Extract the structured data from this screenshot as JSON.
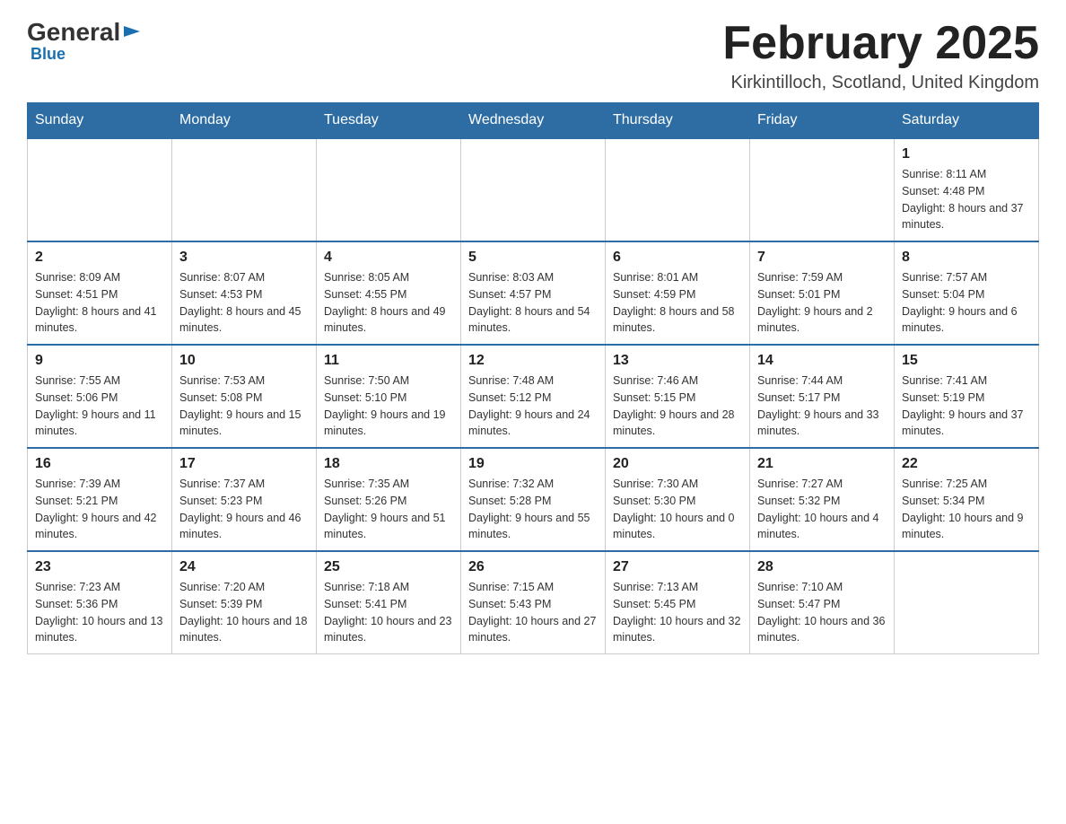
{
  "logo": {
    "general": "General",
    "blue": "Blue"
  },
  "header": {
    "title": "February 2025",
    "subtitle": "Kirkintilloch, Scotland, United Kingdom"
  },
  "weekdays": [
    "Sunday",
    "Monday",
    "Tuesday",
    "Wednesday",
    "Thursday",
    "Friday",
    "Saturday"
  ],
  "weeks": [
    [
      {
        "day": "",
        "info": ""
      },
      {
        "day": "",
        "info": ""
      },
      {
        "day": "",
        "info": ""
      },
      {
        "day": "",
        "info": ""
      },
      {
        "day": "",
        "info": ""
      },
      {
        "day": "",
        "info": ""
      },
      {
        "day": "1",
        "info": "Sunrise: 8:11 AM\nSunset: 4:48 PM\nDaylight: 8 hours and 37 minutes."
      }
    ],
    [
      {
        "day": "2",
        "info": "Sunrise: 8:09 AM\nSunset: 4:51 PM\nDaylight: 8 hours and 41 minutes."
      },
      {
        "day": "3",
        "info": "Sunrise: 8:07 AM\nSunset: 4:53 PM\nDaylight: 8 hours and 45 minutes."
      },
      {
        "day": "4",
        "info": "Sunrise: 8:05 AM\nSunset: 4:55 PM\nDaylight: 8 hours and 49 minutes."
      },
      {
        "day": "5",
        "info": "Sunrise: 8:03 AM\nSunset: 4:57 PM\nDaylight: 8 hours and 54 minutes."
      },
      {
        "day": "6",
        "info": "Sunrise: 8:01 AM\nSunset: 4:59 PM\nDaylight: 8 hours and 58 minutes."
      },
      {
        "day": "7",
        "info": "Sunrise: 7:59 AM\nSunset: 5:01 PM\nDaylight: 9 hours and 2 minutes."
      },
      {
        "day": "8",
        "info": "Sunrise: 7:57 AM\nSunset: 5:04 PM\nDaylight: 9 hours and 6 minutes."
      }
    ],
    [
      {
        "day": "9",
        "info": "Sunrise: 7:55 AM\nSunset: 5:06 PM\nDaylight: 9 hours and 11 minutes."
      },
      {
        "day": "10",
        "info": "Sunrise: 7:53 AM\nSunset: 5:08 PM\nDaylight: 9 hours and 15 minutes."
      },
      {
        "day": "11",
        "info": "Sunrise: 7:50 AM\nSunset: 5:10 PM\nDaylight: 9 hours and 19 minutes."
      },
      {
        "day": "12",
        "info": "Sunrise: 7:48 AM\nSunset: 5:12 PM\nDaylight: 9 hours and 24 minutes."
      },
      {
        "day": "13",
        "info": "Sunrise: 7:46 AM\nSunset: 5:15 PM\nDaylight: 9 hours and 28 minutes."
      },
      {
        "day": "14",
        "info": "Sunrise: 7:44 AM\nSunset: 5:17 PM\nDaylight: 9 hours and 33 minutes."
      },
      {
        "day": "15",
        "info": "Sunrise: 7:41 AM\nSunset: 5:19 PM\nDaylight: 9 hours and 37 minutes."
      }
    ],
    [
      {
        "day": "16",
        "info": "Sunrise: 7:39 AM\nSunset: 5:21 PM\nDaylight: 9 hours and 42 minutes."
      },
      {
        "day": "17",
        "info": "Sunrise: 7:37 AM\nSunset: 5:23 PM\nDaylight: 9 hours and 46 minutes."
      },
      {
        "day": "18",
        "info": "Sunrise: 7:35 AM\nSunset: 5:26 PM\nDaylight: 9 hours and 51 minutes."
      },
      {
        "day": "19",
        "info": "Sunrise: 7:32 AM\nSunset: 5:28 PM\nDaylight: 9 hours and 55 minutes."
      },
      {
        "day": "20",
        "info": "Sunrise: 7:30 AM\nSunset: 5:30 PM\nDaylight: 10 hours and 0 minutes."
      },
      {
        "day": "21",
        "info": "Sunrise: 7:27 AM\nSunset: 5:32 PM\nDaylight: 10 hours and 4 minutes."
      },
      {
        "day": "22",
        "info": "Sunrise: 7:25 AM\nSunset: 5:34 PM\nDaylight: 10 hours and 9 minutes."
      }
    ],
    [
      {
        "day": "23",
        "info": "Sunrise: 7:23 AM\nSunset: 5:36 PM\nDaylight: 10 hours and 13 minutes."
      },
      {
        "day": "24",
        "info": "Sunrise: 7:20 AM\nSunset: 5:39 PM\nDaylight: 10 hours and 18 minutes."
      },
      {
        "day": "25",
        "info": "Sunrise: 7:18 AM\nSunset: 5:41 PM\nDaylight: 10 hours and 23 minutes."
      },
      {
        "day": "26",
        "info": "Sunrise: 7:15 AM\nSunset: 5:43 PM\nDaylight: 10 hours and 27 minutes."
      },
      {
        "day": "27",
        "info": "Sunrise: 7:13 AM\nSunset: 5:45 PM\nDaylight: 10 hours and 32 minutes."
      },
      {
        "day": "28",
        "info": "Sunrise: 7:10 AM\nSunset: 5:47 PM\nDaylight: 10 hours and 36 minutes."
      },
      {
        "day": "",
        "info": ""
      }
    ]
  ]
}
